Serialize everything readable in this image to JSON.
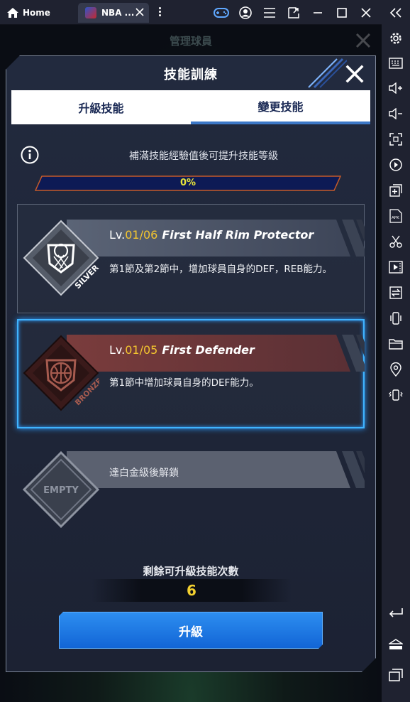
{
  "browser": {
    "home_label": "Home",
    "tab_label": "NBA ..."
  },
  "game_bg_title": "管理球員",
  "dialog": {
    "title": "技能訓練",
    "tabs": [
      {
        "label": "升級技能",
        "active": true
      },
      {
        "label": "變更技能",
        "active": false
      }
    ],
    "info_text": "補滿技能經驗值後可提升技能等級",
    "progress": {
      "label": "0%",
      "value": 0
    }
  },
  "skills": [
    {
      "lv_prefix": "Lv.",
      "level": "01/06",
      "name": "First Half Rim Protector",
      "tier": "SILVER",
      "description": "第1節及第2節中，增加球員自身的DEF，REB能力。",
      "selected": false
    },
    {
      "lv_prefix": "Lv.",
      "level": "01/05",
      "name": "First Defender",
      "tier": "BRONZE",
      "description": "第1節中增加球員自身的DEF能力。",
      "selected": true
    },
    {
      "slot": "EMPTY",
      "lock_text": "達白金級後解鎖"
    }
  ],
  "remaining": {
    "label": "剩餘可升級技能次數",
    "count": "6"
  },
  "upgrade_button": "升級",
  "colors": {
    "accent_yellow": "#f3c52f",
    "select_blue": "#3fb4ff",
    "button_blue": "#1f7ae3"
  }
}
